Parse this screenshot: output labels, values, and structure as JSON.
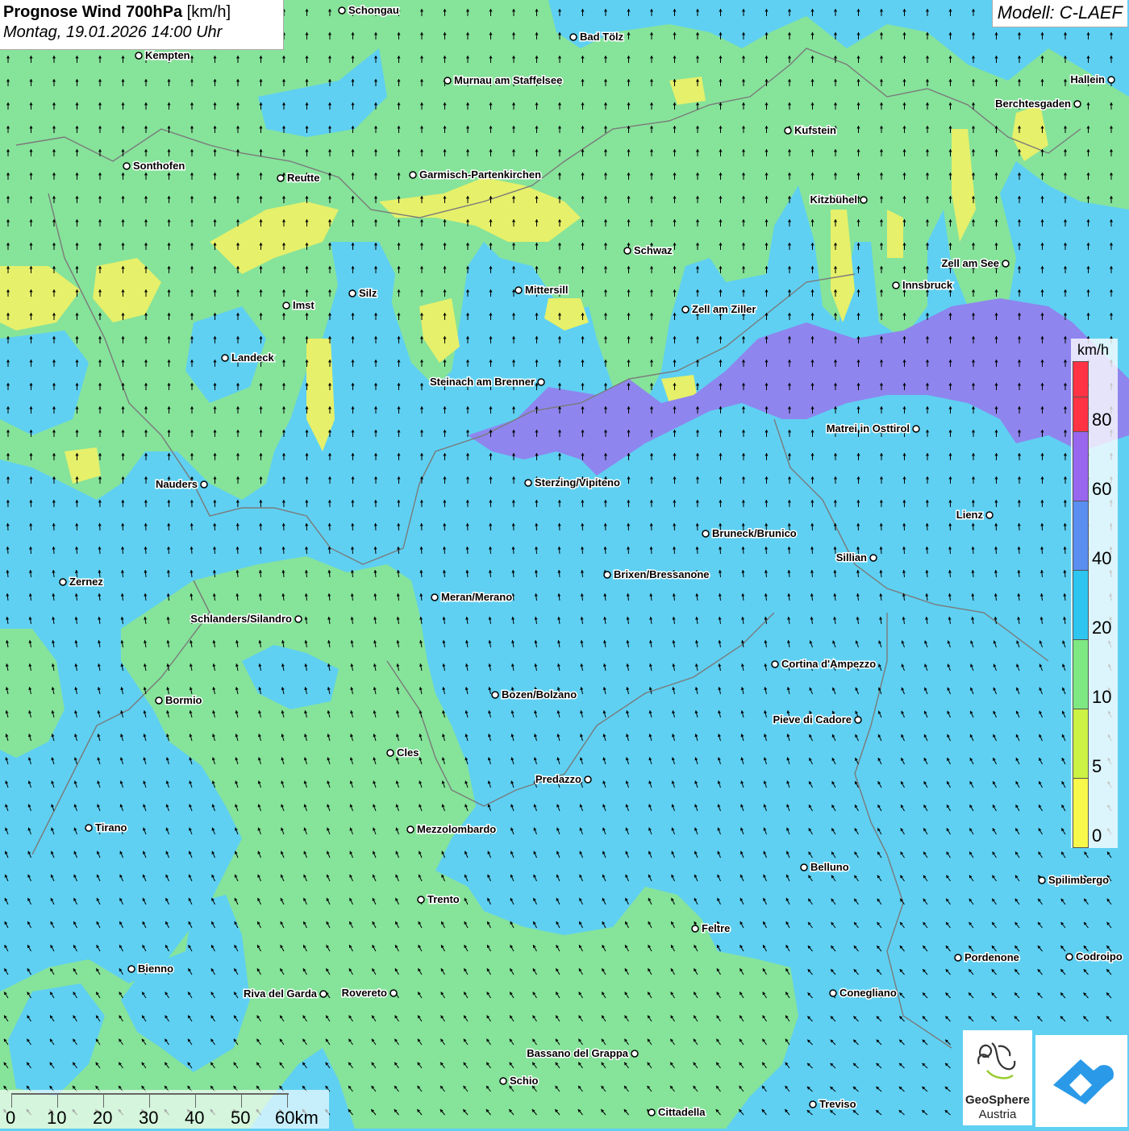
{
  "header": {
    "title_bold": "Prognose Wind 700hPa",
    "title_unit": " [km/h]",
    "datetime": "Montag, 19.01.2026 14:00 Uhr"
  },
  "model": "Modell: C-LAEF",
  "legend": {
    "unit": "km/h",
    "labels": [
      "80",
      "60",
      "40",
      "20",
      "10",
      "5",
      "0"
    ],
    "colors": [
      "#ff3333",
      "#ff3333",
      "#9966ee",
      "#5a8ef0",
      "#2ec5f0",
      "#7ee882",
      "#ccf244",
      "#f8f84a"
    ]
  },
  "scalebar": {
    "labels": [
      "0",
      "10",
      "20",
      "30",
      "40",
      "50",
      "60km"
    ]
  },
  "logos": {
    "geosphere_line1": "GeoSphere",
    "geosphere_line2": "Austria"
  },
  "cities": [
    {
      "name": "Schongau"
    },
    {
      "name": "Bad Tölz"
    },
    {
      "name": "Kempten"
    },
    {
      "name": "Murnau am Staffelsee"
    },
    {
      "name": "Hallein"
    },
    {
      "name": "Berchtesgaden"
    },
    {
      "name": "Kufstein"
    },
    {
      "name": "Sonthofen"
    },
    {
      "name": "Reutte"
    },
    {
      "name": "Garmisch-Partenkirchen"
    },
    {
      "name": "Kitzbühel"
    },
    {
      "name": "Schwaz"
    },
    {
      "name": "Zell am See"
    },
    {
      "name": "Innsbruck"
    },
    {
      "name": "Mittersill"
    },
    {
      "name": "Silz"
    },
    {
      "name": "Imst"
    },
    {
      "name": "Zell am Ziller"
    },
    {
      "name": "Landeck"
    },
    {
      "name": "Steinach am Brenner"
    },
    {
      "name": "Matrei in Osttirol"
    },
    {
      "name": "Nauders"
    },
    {
      "name": "Sterzing/Vipiteno"
    },
    {
      "name": "Lienz"
    },
    {
      "name": "Bruneck/Brunico"
    },
    {
      "name": "Sillian"
    },
    {
      "name": "Zernez"
    },
    {
      "name": "Brixen/Bressanone"
    },
    {
      "name": "Meran/Merano"
    },
    {
      "name": "Schlanders/Silandro"
    },
    {
      "name": "Cortina d'Ampezzo"
    },
    {
      "name": "Bozen/Bolzano"
    },
    {
      "name": "Bormio"
    },
    {
      "name": "Pieve di Cadore"
    },
    {
      "name": "Cles"
    },
    {
      "name": "Predazzo"
    },
    {
      "name": "Tirano"
    },
    {
      "name": "Mezzolombardo"
    },
    {
      "name": "Belluno"
    },
    {
      "name": "Spilimbergo"
    },
    {
      "name": "Trento"
    },
    {
      "name": "Feltre"
    },
    {
      "name": "Pordenone"
    },
    {
      "name": "Codroipo"
    },
    {
      "name": "Bienno"
    },
    {
      "name": "Riva del Garda"
    },
    {
      "name": "Rovereto"
    },
    {
      "name": "Conegliano"
    },
    {
      "name": "Bassano del Grappa"
    },
    {
      "name": "Schio"
    },
    {
      "name": "Treviso"
    },
    {
      "name": "Cittadella"
    }
  ]
}
